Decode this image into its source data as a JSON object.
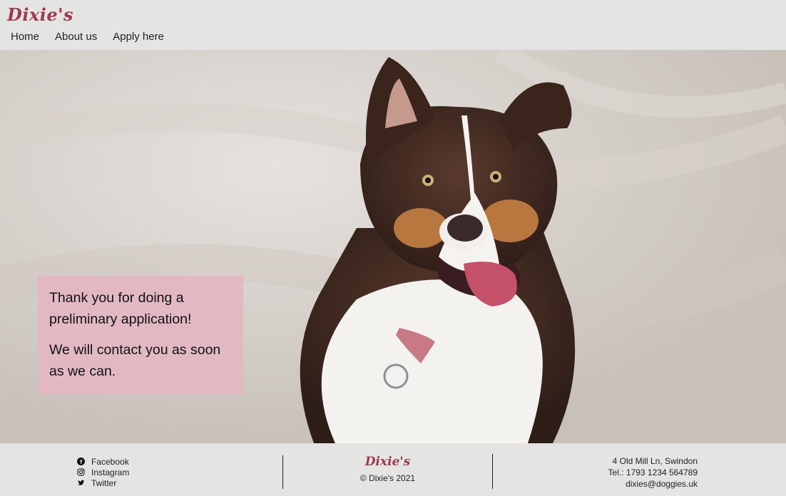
{
  "header": {
    "logo": "Dixie's",
    "nav": [
      "Home",
      "About us",
      "Apply here"
    ]
  },
  "hero": {
    "image": "dog-photo",
    "message": [
      "Thank you for doing a preliminary application!",
      "We will contact you as soon as we can."
    ],
    "message_bg": "#e2b9c2"
  },
  "footer": {
    "social": [
      {
        "icon": "facebook-icon",
        "label": "Facebook"
      },
      {
        "icon": "instagram-icon",
        "label": "Instagram"
      },
      {
        "icon": "twitter-icon",
        "label": "Twitter"
      }
    ],
    "logo": "Dixie's",
    "copyright": "© Dixie's 2021",
    "address": "4 Old Mill Ln, Swindon",
    "phone": "Tel.: 1793 1234 564789",
    "email": "dixies@doggies.uk"
  },
  "colors": {
    "brand": "#9b3a4f",
    "background": "#e4e4e2"
  }
}
